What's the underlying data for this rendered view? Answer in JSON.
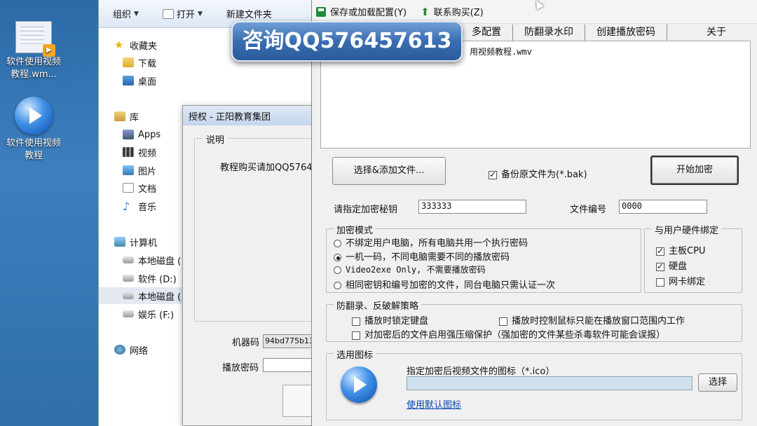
{
  "desktop": {
    "icons": [
      {
        "label": "软件使用视频教程.wm..."
      },
      {
        "label": "软件使用视频教程"
      }
    ],
    "video_badge": "▶"
  },
  "explorer": {
    "toolbar": {
      "organize": "组织",
      "open": "打开",
      "new_folder": "新建文件夹"
    },
    "nav": {
      "favorites": "收藏夹",
      "downloads": "下载",
      "desktop": "桌面",
      "libraries": "库",
      "apps": "Apps",
      "videos": "视频",
      "pictures": "图片",
      "documents": "文档",
      "music": "音乐",
      "computer": "计算机",
      "local_disk_1": "本地磁盘 (",
      "software_d": "软件 (D:)",
      "local_disk_2": "本地磁盘 (",
      "entertainment_f": "娱乐 (F:)",
      "network": "网络"
    }
  },
  "auth_dialog": {
    "title": "授权 - 正阳教育集团",
    "group_label": "说明",
    "description": "教程购买请加QQ57645",
    "machine_code_label": "机器码",
    "machine_code_value": "94bd775b13",
    "play_password_label": "播放密码",
    "play_password_value": ""
  },
  "overlay": {
    "banner_text": "咨询QQ576457613"
  },
  "main": {
    "menu": {
      "save_load": "保存或加载配置(Y)",
      "contact_buy": "联系购买(Z)"
    },
    "tabs": [
      "多配置",
      "防翻录水印",
      "创建播放密码",
      "关于"
    ],
    "file_list": [
      "用视频教程.wmv"
    ],
    "add_file_button": "选择&添加文件...",
    "backup_checkbox": {
      "label": "备份原文件为(*.bak)",
      "checked": true
    },
    "start_button": "开始加密",
    "key_label": "请指定加密秘钥",
    "key_value": "333333",
    "file_no_label": "文件编号",
    "file_no_value": "0000",
    "mode_group": {
      "title": "加密模式",
      "options": [
        {
          "label": "不绑定用户电脑，所有电脑共用一个执行密码",
          "selected": false
        },
        {
          "label": "一机一码，不同电脑需要不同的播放密码",
          "selected": true
        },
        {
          "label": "Video2exe Only, 不需要播放密码",
          "selected": false
        },
        {
          "label": "相同密钥和编号加密的文件，同台电脑只需认证一次",
          "selected": false
        }
      ]
    },
    "hardware_group": {
      "title": "与用户硬件绑定",
      "options": [
        {
          "label": "主板CPU",
          "checked": true
        },
        {
          "label": "硬盘",
          "checked": true
        },
        {
          "label": "网卡绑定",
          "checked": false
        }
      ]
    },
    "anti_group": {
      "title": "防翻录、反破解策略",
      "options": [
        {
          "label": "播放时锁定键盘",
          "checked": false
        },
        {
          "label": "播放时控制鼠标只能在播放窗口范围内工作",
          "checked": false
        },
        {
          "label": "对加密后的文件启用强压缩保护（强加密的文件某些杀毒软件可能会误报）",
          "checked": false
        }
      ]
    },
    "icon_group": {
      "title": "选用图标",
      "desc": "指定加密后视频文件的图标（*.ico）",
      "path_value": "",
      "choose_button": "选择",
      "default_link": "使用默认图标"
    }
  }
}
